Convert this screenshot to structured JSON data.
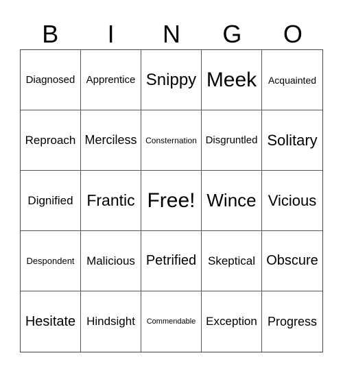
{
  "header": {
    "letters": [
      "B",
      "I",
      "N",
      "G",
      "O"
    ]
  },
  "card": {
    "rows": [
      [
        "Diagnosed",
        "Apprentice",
        "Snippy",
        "Meek",
        "Acquainted"
      ],
      [
        "Reproach",
        "Merciless",
        "Consternation",
        "Disgruntled",
        "Solitary"
      ],
      [
        "Dignified",
        "Frantic",
        "Free!",
        "Wince",
        "Vicious"
      ],
      [
        "Despondent",
        "Malicious",
        "Petrified",
        "Skeptical",
        "Obscure"
      ],
      [
        "Hesitate",
        "Hindsight",
        "Commendable",
        "Exception",
        "Progress"
      ]
    ]
  }
}
